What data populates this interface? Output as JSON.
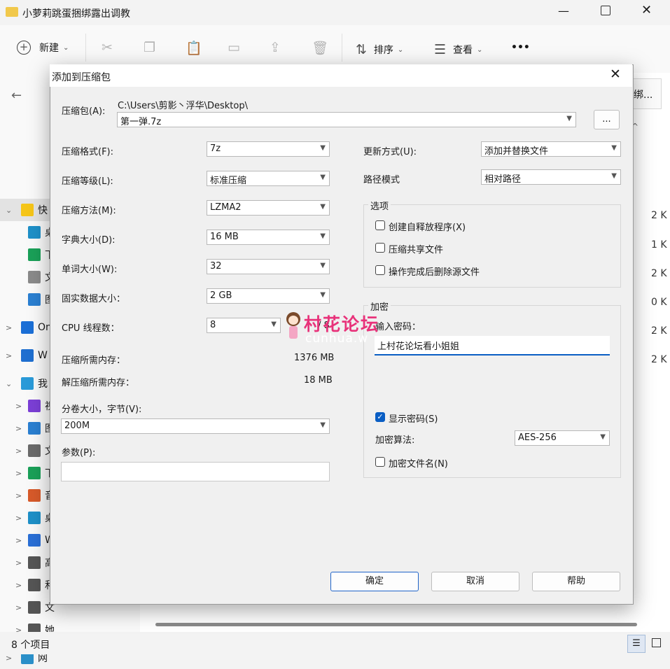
{
  "explorer": {
    "title": "小萝莉跳蛋捆绑露出调教",
    "toolbar": {
      "new_label": "新建",
      "sort_label": "排序",
      "view_label": "查看",
      "more_label": "•••"
    },
    "search_label": "绑...",
    "nav_items": [
      "快",
      "桌",
      "下",
      "文",
      "图",
      "On",
      "W",
      "我",
      "视",
      "图",
      "文",
      "下",
      "音",
      "桌",
      "W",
      "高",
      "和",
      "文",
      "她",
      "网"
    ],
    "sizes": [
      "2 K",
      "1 K",
      "2 K",
      "0 K",
      "2 K",
      "2 K"
    ],
    "status": "8 个项目"
  },
  "dialog": {
    "title": "添加到压缩包",
    "archive_label": "压缩包(A):",
    "archive_path": "C:\\Users\\剪影丶浮华\\Desktop\\",
    "archive_name": "第一弹.7z",
    "browse_label": "...",
    "format_label": "压缩格式(F):",
    "format_value": "7z",
    "level_label": "压缩等级(L):",
    "level_value": "标准压缩",
    "method_label": "压缩方法(M):",
    "method_value": "LZMA2",
    "dict_label": "字典大小(D):",
    "dict_value": "16 MB",
    "word_label": "单词大小(W):",
    "word_value": "32",
    "solid_label": "固实数据大小：",
    "solid_value": "2 GB",
    "cpu_label": "CPU 线程数：",
    "cpu_value": "8",
    "cpu_total": "/ 8",
    "mem_comp_label": "压缩所需内存：",
    "mem_comp_value": "1376 MB",
    "mem_decomp_label": "解压缩所需内存：",
    "mem_decomp_value": "18 MB",
    "volume_label": "分卷大小，字节(V):",
    "volume_value": "200M",
    "params_label": "参数(P):",
    "params_value": "",
    "update_label": "更新方式(U):",
    "update_value": "添加并替换文件",
    "path_label": "路径模式",
    "path_value": "相对路径",
    "options_title": "选项",
    "opt_sfx": "创建自释放程序(X)",
    "opt_shared": "压缩共享文件",
    "opt_delete": "操作完成后删除源文件",
    "enc_title": "加密",
    "enc_pwd_label": "输入密码：",
    "enc_pwd_value": "上村花论坛看小姐姐",
    "show_pwd": "显示密码(S)",
    "enc_method_label": "加密算法:",
    "enc_method_value": "AES-256",
    "enc_names": "加密文件名(N)",
    "ok": "确定",
    "cancel": "取消",
    "help": "帮助"
  },
  "watermark": {
    "title": "村花论坛",
    "url": "cunhua.w"
  },
  "colors": {
    "accent": "#0a5ec4",
    "watermark": "#e8327a"
  }
}
